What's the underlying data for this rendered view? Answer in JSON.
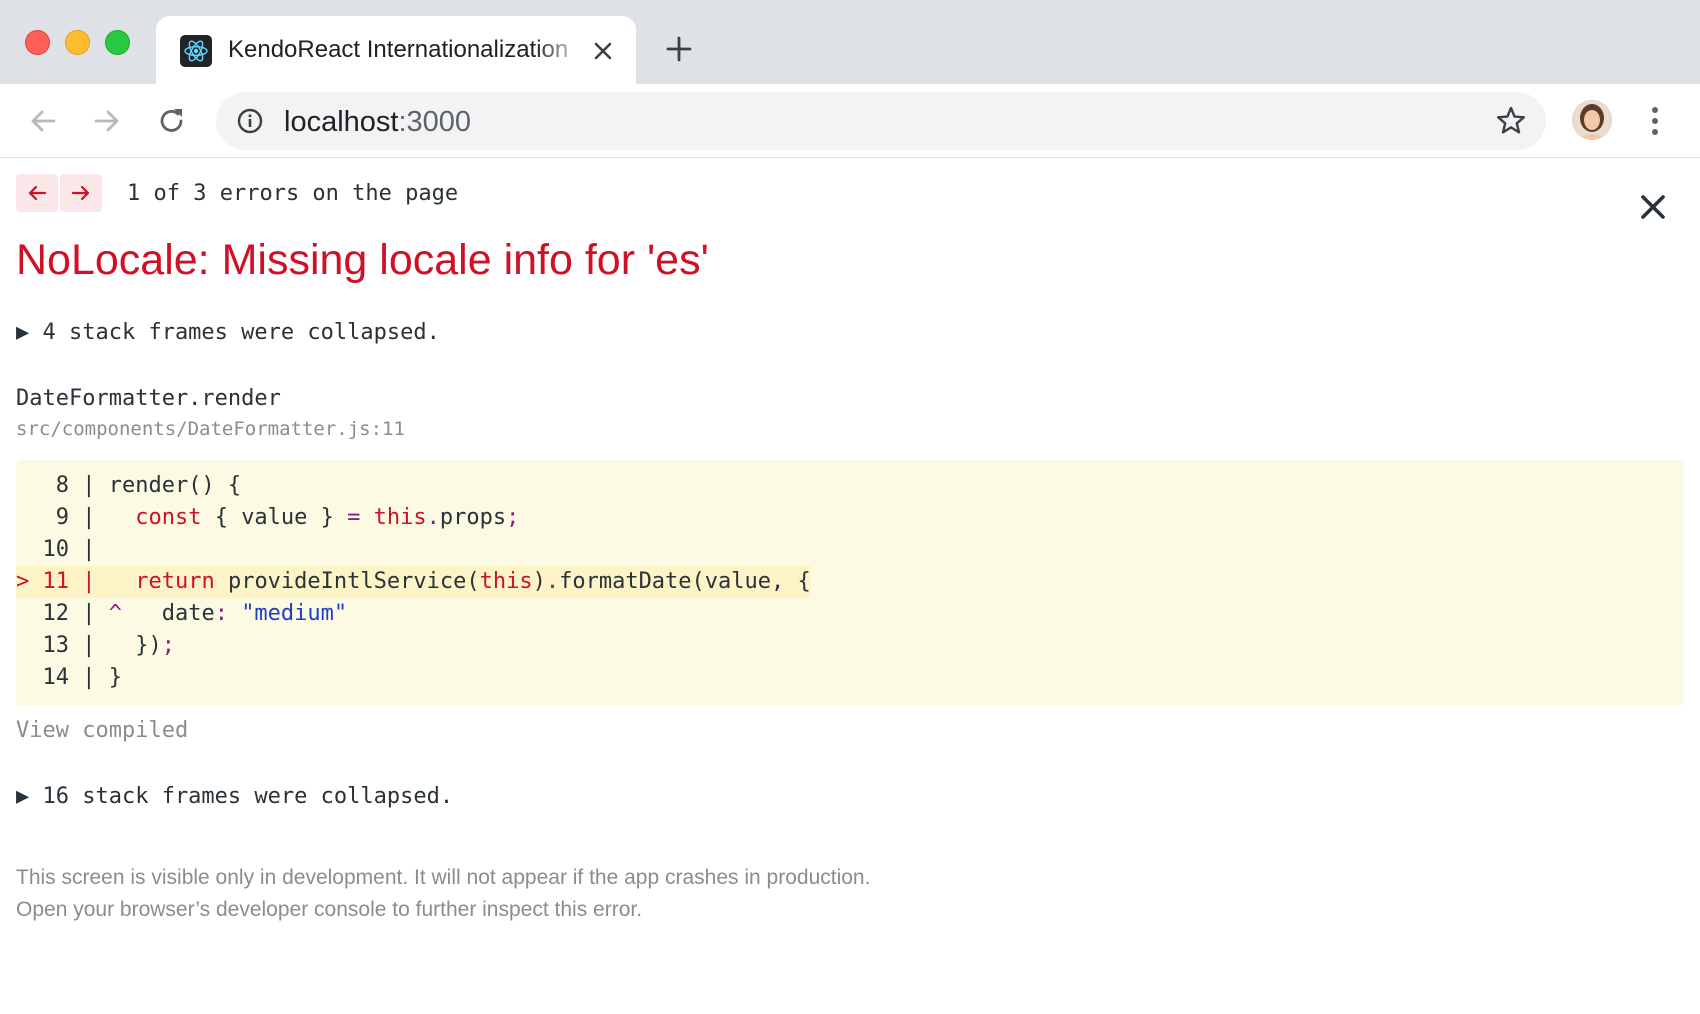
{
  "browser": {
    "tab_title": "KendoReact Internationalization",
    "url_host": "localhost",
    "url_port": ":3000"
  },
  "overlay": {
    "error_count": "1 of 3 errors on the page",
    "title": "NoLocale: Missing locale info for 'es'",
    "collapsed_top": "▶ 4 stack frames were collapsed.",
    "frame_function": "DateFormatter.render",
    "frame_file": "src/components/DateFormatter.js:11",
    "code_lines": [
      {
        "gutter": "   8 | ",
        "code": "render() {"
      },
      {
        "gutter": "   9 | ",
        "code": "  const { value } = this.props;"
      },
      {
        "gutter": "  10 | ",
        "code": ""
      },
      {
        "gutter": "> 11 | ",
        "code": "  return provideIntlService(this).formatDate(value, {"
      },
      {
        "gutter": "  12 | ",
        "code": "^   date: \"medium\""
      },
      {
        "gutter": "  13 | ",
        "code": "  });"
      },
      {
        "gutter": "  14 | ",
        "code": "}"
      }
    ],
    "view_compiled": "View compiled",
    "collapsed_bottom": "▶ 16 stack frames were collapsed.",
    "footer_line1": "This screen is visible only in development. It will not appear if the app crashes in production.",
    "footer_line2": "Open your browser’s developer console to further inspect this error."
  },
  "colors": {
    "error_red": "#ce1126",
    "code_bg": "#fdfae4",
    "highlight_bg": "#fcf3c7",
    "muted_gray": "#878e91"
  },
  "icons": [
    "react-favicon-icon",
    "tab-close-icon",
    "new-tab-icon",
    "back-icon",
    "forward-icon",
    "reload-icon",
    "info-icon",
    "star-icon",
    "kebab-menu-icon",
    "arrow-left-icon",
    "arrow-right-icon",
    "close-icon"
  ]
}
